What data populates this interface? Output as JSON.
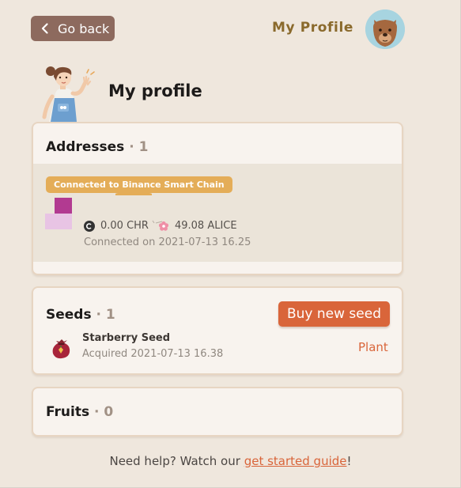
{
  "header": {
    "back_label": "Go back",
    "title": "My Profile",
    "avatar_icon": "bear-avatar"
  },
  "page": {
    "title": "My profile",
    "illustration": "farmer-girl-waving"
  },
  "addresses": {
    "title": "Addresses",
    "separator": "·",
    "count": "1",
    "items": [
      {
        "chain_badge": "Connected to Binance Smart Chain",
        "chr_balance": "0.00 CHR",
        "alice_balance": "49.08 ALICE",
        "connected_on": "Connected on 2021-07-13 16.25"
      }
    ]
  },
  "seeds": {
    "title": "Seeds",
    "separator": "·",
    "count": "1",
    "buy_label": "Buy new seed",
    "items": [
      {
        "name": "Starberry Seed",
        "acquired": "Acquired 2021-07-13 16.38",
        "action_label": "Plant"
      }
    ]
  },
  "fruits": {
    "title": "Fruits",
    "separator": "·",
    "count": "0"
  },
  "footer": {
    "help_prefix": "Need help? Watch our ",
    "help_link": "get started guide",
    "help_suffix": "!"
  },
  "colors": {
    "background": "#efe7dd",
    "back_button": "#8d6a5e",
    "header_title": "#8a6a2c",
    "card": "#f8f3ee",
    "card_border": "#e7d5c2",
    "chain_badge": "#e4ad58",
    "accent": "#d9653a"
  }
}
